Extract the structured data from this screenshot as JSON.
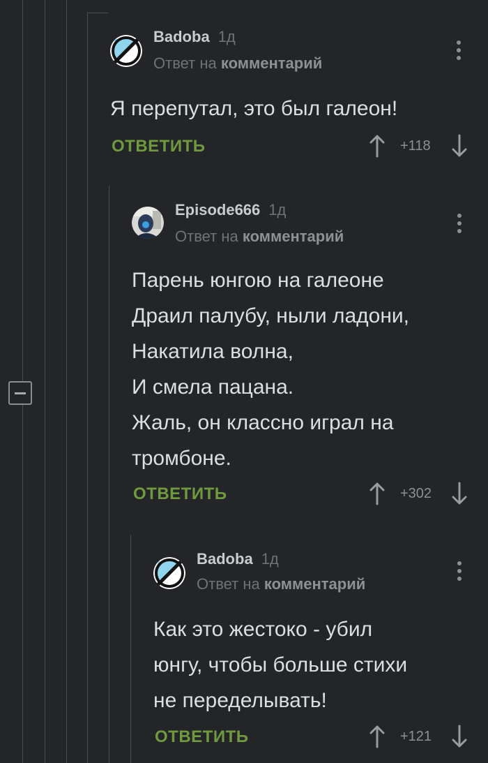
{
  "comments": [
    {
      "username": "Badoba",
      "time": "1д",
      "reply_prefix": "Ответ на",
      "reply_target": "комментарий",
      "lines": [
        "Я перепутал, это был галеон!"
      ],
      "reply_label": "ОТВЕТИТЬ",
      "score": "+118",
      "avatar": "badoba-avatar"
    },
    {
      "username": "Episode666",
      "time": "1д",
      "reply_prefix": "Ответ на",
      "reply_target": "комментарий",
      "lines": [
        "Парень юнгою на галеоне",
        "Драил палубу, ныли ладони,",
        "Накатила волна,",
        "И смела пацана.",
        "Жаль, он классно играл на",
        "тромбоне."
      ],
      "reply_label": "ОТВЕТИТЬ",
      "score": "+302",
      "avatar": "episode666-avatar"
    },
    {
      "username": "Badoba",
      "time": "1д",
      "reply_prefix": "Ответ на",
      "reply_target": "комментарий",
      "lines": [
        "Как это жестоко - убил",
        "юнгу, чтобы больше стихи",
        "не переделывать!"
      ],
      "reply_label": "ОТВЕТИТЬ",
      "score": "+121",
      "avatar": "badoba-avatar"
    }
  ],
  "icons": {
    "collapse": "minus-square-icon",
    "more": "more-vertical-icon",
    "upvote": "arrow-up-icon",
    "downvote": "arrow-down-icon"
  },
  "colors": {
    "background": "#232528",
    "accent_green": "#6f9a3d",
    "text_primary": "#dcdee1",
    "text_muted": "#707276"
  }
}
